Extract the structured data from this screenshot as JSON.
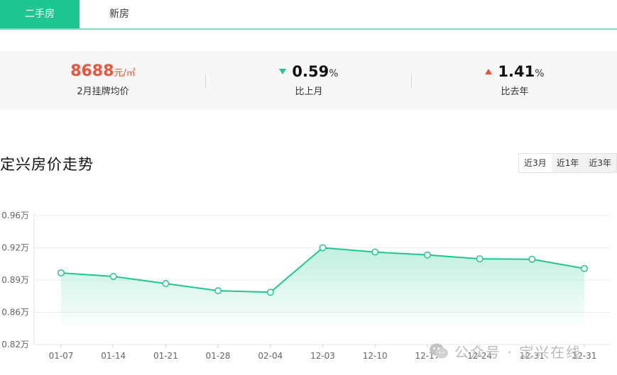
{
  "tabs": [
    {
      "label": "二手房",
      "active": true
    },
    {
      "label": "新房",
      "active": false
    }
  ],
  "stats": {
    "avg_price": {
      "value": "8688",
      "unit": "元/㎡",
      "label": "2月挂牌均价"
    },
    "month_change": {
      "value": "0.59",
      "sign": "%",
      "direction": "down",
      "label": "比上月"
    },
    "year_change": {
      "value": "1.41",
      "sign": "%",
      "direction": "up",
      "label": "比去年"
    }
  },
  "section": {
    "title": "定兴房价走势"
  },
  "range_buttons": [
    {
      "label": "近3月",
      "active": true
    },
    {
      "label": "近1年",
      "active": false
    },
    {
      "label": "近3年",
      "active": false
    }
  ],
  "watermark": {
    "text": "公众号 · 定兴在线"
  },
  "colors": {
    "accent": "#1fc790",
    "price": "#f0533a",
    "tab_active": "#1fc790"
  },
  "chart_data": {
    "type": "area",
    "x": [
      "01-07",
      "01-14",
      "01-21",
      "01-28",
      "02-04",
      "12-03",
      "12-10",
      "12-17",
      "12-24",
      "12-31",
      "12-31"
    ],
    "series": [
      {
        "values": [
          0.8866,
          0.8833,
          0.8767,
          0.87,
          0.8686,
          0.91,
          0.906,
          0.9033,
          0.8997,
          0.8993,
          0.8907
        ]
      }
    ],
    "y_ticks": [
      "0.82万",
      "0.86万",
      "0.89万",
      "0.92万",
      "0.96万"
    ],
    "y_tick_values": [
      0.82,
      0.85,
      0.88,
      0.91,
      0.94
    ],
    "ylim": [
      0.82,
      0.94
    ],
    "grid": true
  }
}
